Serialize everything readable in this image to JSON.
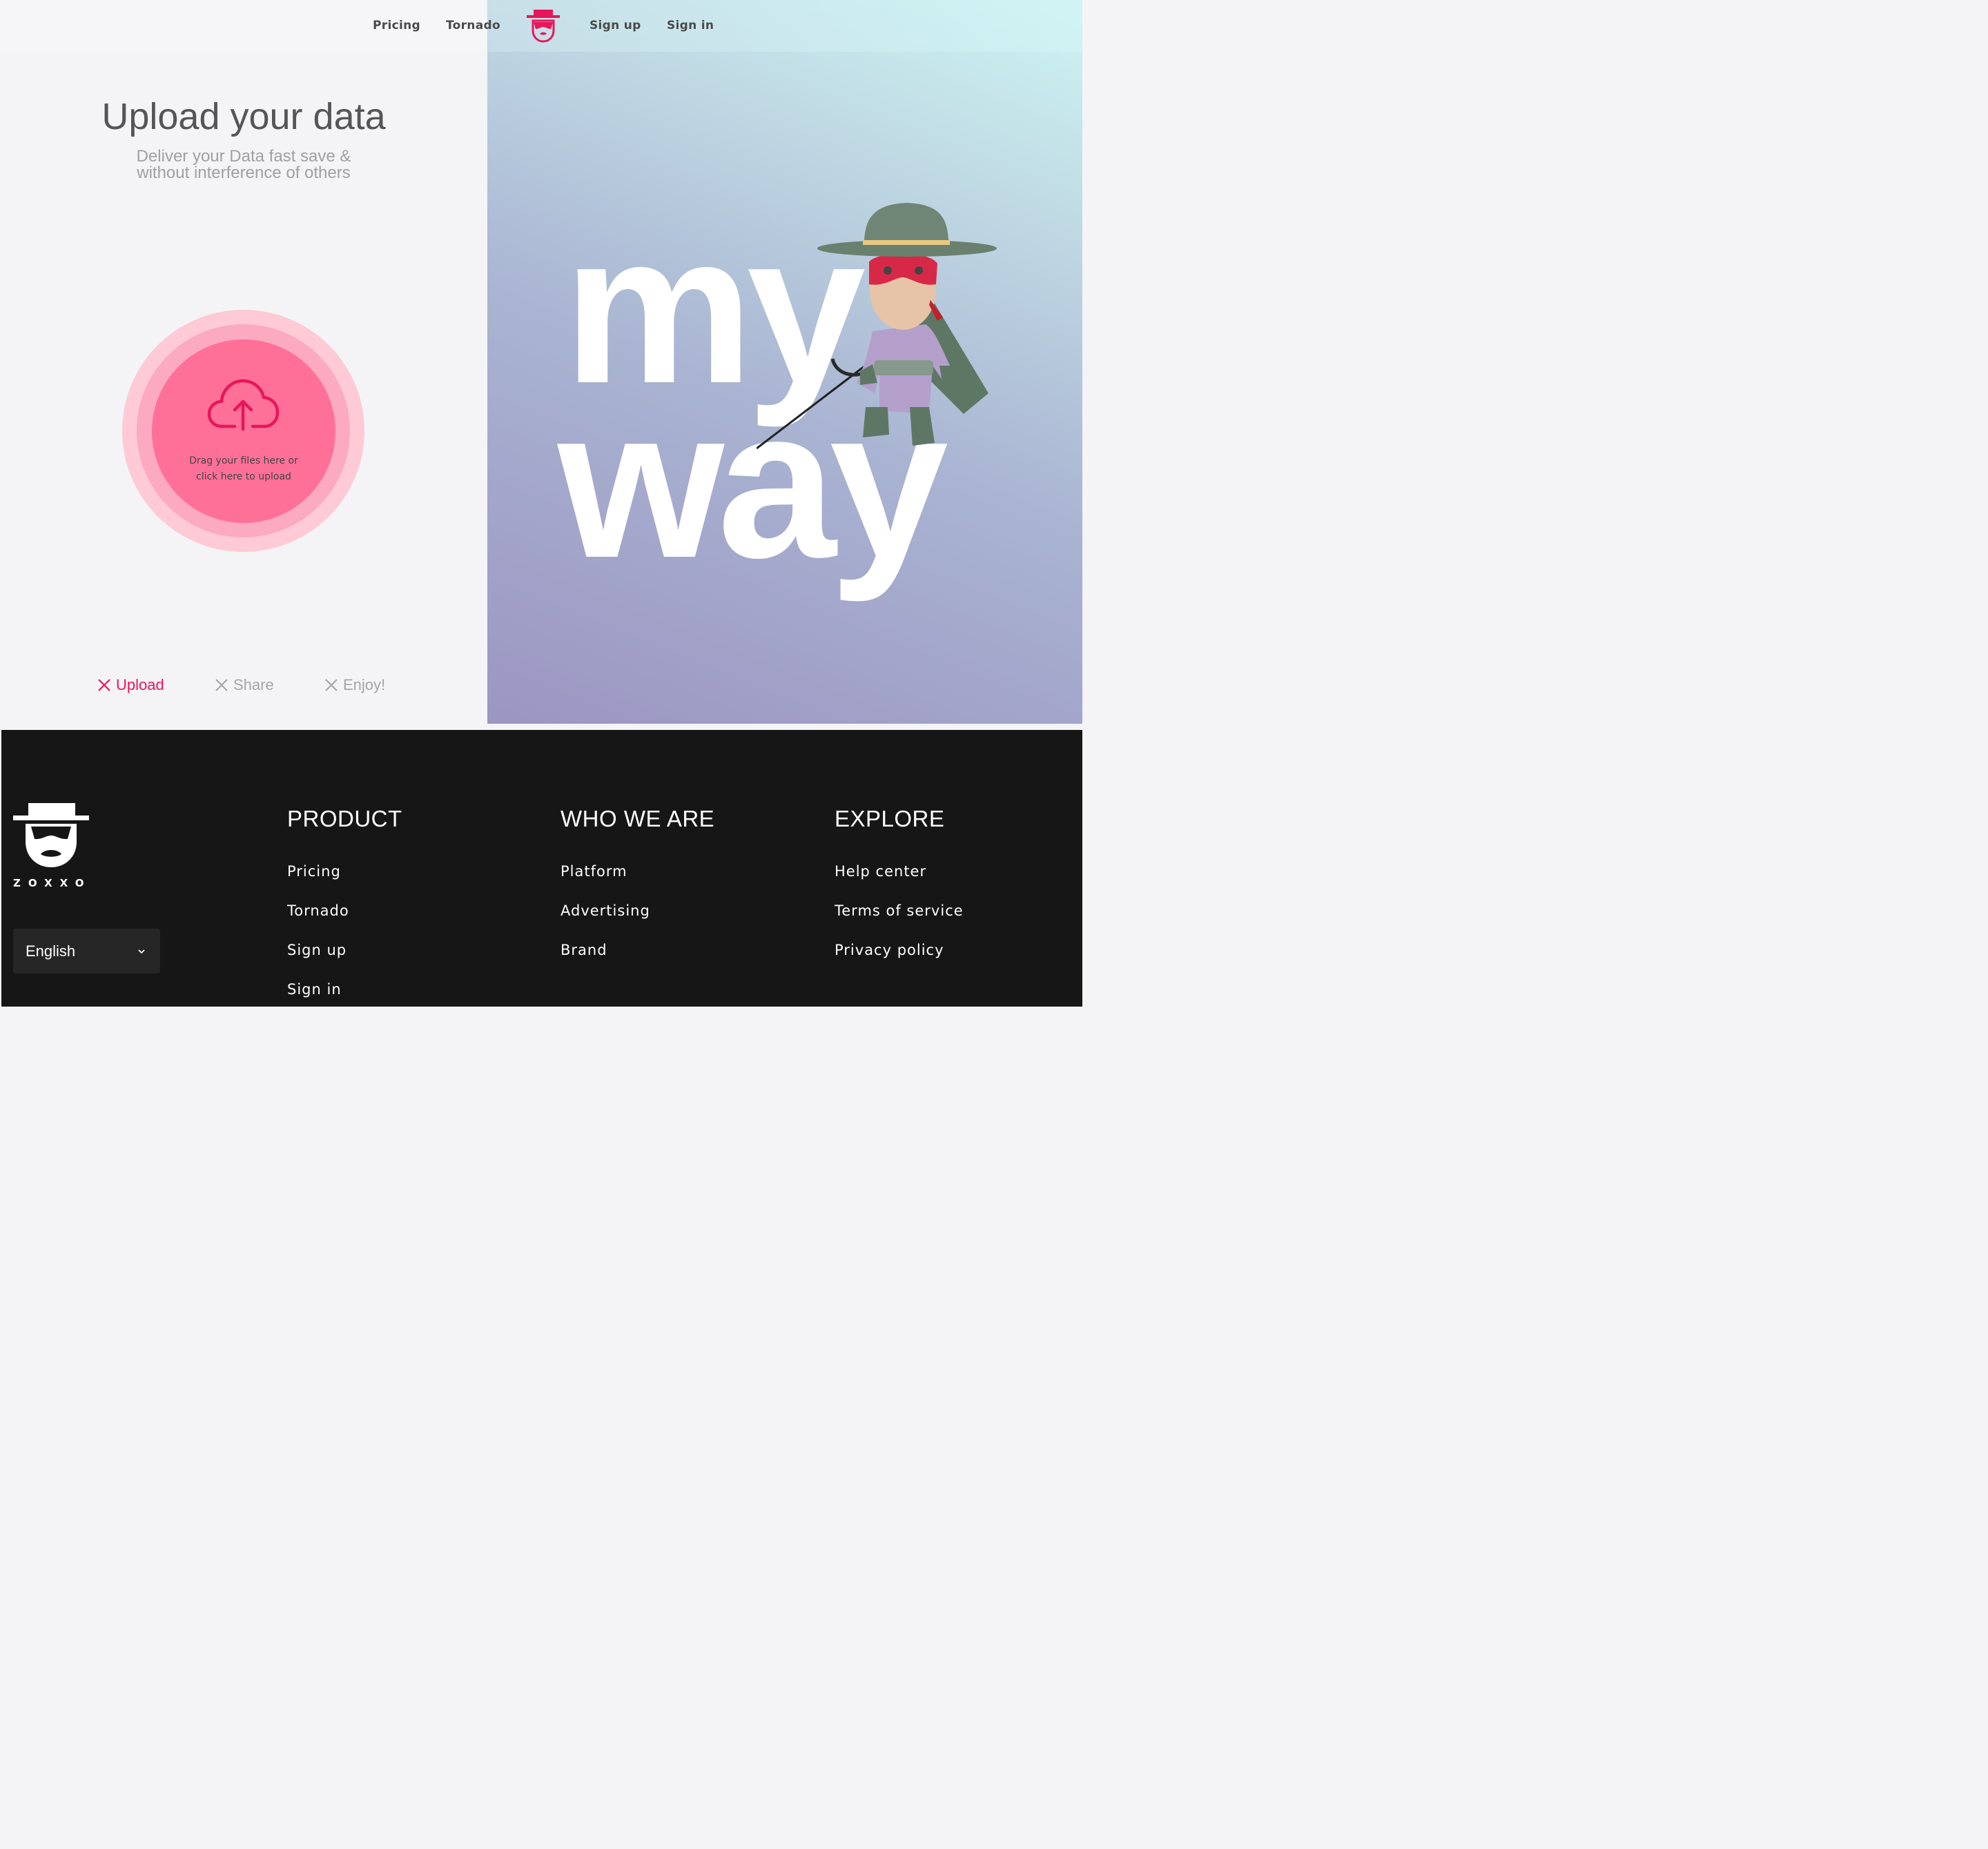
{
  "nav": {
    "pricing": "Pricing",
    "tornado": "Tornado",
    "signup": "Sign up",
    "signin": "Sign in",
    "logo_icon": "zorro-mask-logo-icon"
  },
  "upload": {
    "title": "Upload your data",
    "subtitle_line1": "Deliver your Data fast save &",
    "subtitle_line2": "without interference of others",
    "drop_line1": "Drag your files here or",
    "drop_line2": "click here to upload",
    "icon": "cloud-upload-icon"
  },
  "steps": [
    {
      "label": "Upload",
      "active": true
    },
    {
      "label": "Share",
      "active": false
    },
    {
      "label": "Enjoy!",
      "active": false
    }
  ],
  "hero": {
    "word1": "my",
    "word2": "way",
    "image": "zorro-character-illustration"
  },
  "footer": {
    "brand": "ZOXXO",
    "language": "English",
    "product": {
      "heading": "PRODUCT",
      "links": [
        "Pricing",
        "Tornado",
        "Sign up",
        "Sign in"
      ]
    },
    "who": {
      "heading": "WHO WE ARE",
      "links": [
        "Platform",
        "Advertising",
        "Brand"
      ]
    },
    "explore": {
      "heading": "EXPLORE",
      "links": [
        "Help center",
        "Terms of service",
        "Privacy policy"
      ]
    }
  },
  "colors": {
    "accent": "#e8165a",
    "upload_circle": "#ff7099",
    "footer_bg": "#161616"
  }
}
